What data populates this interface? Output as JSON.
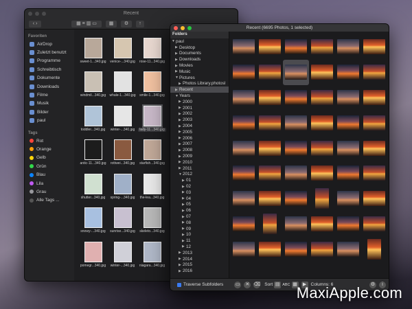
{
  "finder": {
    "title": "Recent",
    "favorites_header": "Favoriten",
    "favorites": [
      "AirDrop",
      "Zuletzt benutzt",
      "Programme",
      "Schreibtisch",
      "Dokumente",
      "Downloads",
      "Filme",
      "Musik",
      "Bilder",
      "paul"
    ],
    "tags_header": "Tags",
    "tags": [
      {
        "label": "Rot",
        "color": "#ff453a"
      },
      {
        "label": "Orange",
        "color": "#ff9f0a"
      },
      {
        "label": "Gelb",
        "color": "#ffd60a"
      },
      {
        "label": "Grün",
        "color": "#32d74b"
      },
      {
        "label": "Blau",
        "color": "#0a84ff"
      },
      {
        "label": "Lila",
        "color": "#bf5af2"
      },
      {
        "label": "Grau",
        "color": "#98989d"
      },
      {
        "label": "Alle Tags ...",
        "color": "#555555"
      }
    ],
    "files": [
      "sweet-1...340.jpg",
      "venice-...340.jpg",
      "rose-11...340.jpg",
      "windmil...340.jpg",
      "whale-1...340.jpg",
      "smile-1...340.jpg",
      "toddler...340.jpg",
      "winter-...340.jpg",
      "lady-11...340.jpg",
      "antic-11...340.jpg",
      "rottwei...340.jpg",
      "starfish...340.jpg",
      "shutter...340.jpg",
      "spring-...340.jpg",
      "the-lea...340.jpg",
      "snowy-...340.jpg",
      "sunrise...340.jpg",
      "skeleto...340.jpg",
      "pomegr...340.jpg",
      "winter-...340.jpg",
      "niagara...340.jpg"
    ],
    "selected_file_index": 8
  },
  "viewer": {
    "title": "Recent (6695 Photos, 1 selected)",
    "folders_header": "Folders",
    "tree": [
      {
        "label": "paul",
        "depth": 0,
        "arrow": "▼"
      },
      {
        "label": "Desktop",
        "depth": 1,
        "arrow": "▶"
      },
      {
        "label": "Documents",
        "depth": 1,
        "arrow": "▶"
      },
      {
        "label": "Downloads",
        "depth": 1,
        "arrow": "▶"
      },
      {
        "label": "Movies",
        "depth": 1,
        "arrow": "▶"
      },
      {
        "label": "Music",
        "depth": 1,
        "arrow": "▶"
      },
      {
        "label": "Pictures",
        "depth": 1,
        "arrow": "▼"
      },
      {
        "label": "Photos Library.photosl",
        "depth": 2,
        "arrow": "▶"
      },
      {
        "label": "Recent",
        "depth": 1,
        "arrow": "▶",
        "selected": true
      },
      {
        "label": "Years",
        "depth": 1,
        "arrow": "▼"
      },
      {
        "label": "2000",
        "depth": 2,
        "arrow": "▶"
      },
      {
        "label": "2001",
        "depth": 2,
        "arrow": "▶"
      },
      {
        "label": "2002",
        "depth": 2,
        "arrow": "▶"
      },
      {
        "label": "2003",
        "depth": 2,
        "arrow": "▶"
      },
      {
        "label": "2004",
        "depth": 2,
        "arrow": "▶"
      },
      {
        "label": "2005",
        "depth": 2,
        "arrow": "▶"
      },
      {
        "label": "2006",
        "depth": 2,
        "arrow": "▶"
      },
      {
        "label": "2007",
        "depth": 2,
        "arrow": "▶"
      },
      {
        "label": "2008",
        "depth": 2,
        "arrow": "▶"
      },
      {
        "label": "2009",
        "depth": 2,
        "arrow": "▶"
      },
      {
        "label": "2010",
        "depth": 2,
        "arrow": "▶"
      },
      {
        "label": "2011",
        "depth": 2,
        "arrow": "▶"
      },
      {
        "label": "2012",
        "depth": 2,
        "arrow": "▼"
      },
      {
        "label": "01",
        "depth": 3,
        "arrow": "▶"
      },
      {
        "label": "02",
        "depth": 3,
        "arrow": "▶"
      },
      {
        "label": "03",
        "depth": 3,
        "arrow": "▶"
      },
      {
        "label": "04",
        "depth": 3,
        "arrow": "▶"
      },
      {
        "label": "05",
        "depth": 3,
        "arrow": "▶"
      },
      {
        "label": "06",
        "depth": 3,
        "arrow": "▶"
      },
      {
        "label": "07",
        "depth": 3,
        "arrow": "▶"
      },
      {
        "label": "08",
        "depth": 3,
        "arrow": "▶"
      },
      {
        "label": "09",
        "depth": 3,
        "arrow": "▶"
      },
      {
        "label": "10",
        "depth": 3,
        "arrow": "▶"
      },
      {
        "label": "11",
        "depth": 3,
        "arrow": "▶"
      },
      {
        "label": "12",
        "depth": 3,
        "arrow": "▶"
      },
      {
        "label": "2013",
        "depth": 2,
        "arrow": "▶"
      },
      {
        "label": "2014",
        "depth": 2,
        "arrow": "▶"
      },
      {
        "label": "2015",
        "depth": 2,
        "arrow": "▶"
      },
      {
        "label": "2016",
        "depth": 2,
        "arrow": "▶"
      }
    ],
    "selected_photo_index": 8,
    "bottom": {
      "traverse_label": "Traverse Subfolders",
      "sort_label": "Sort",
      "abc_label": "ABC",
      "columns_label": "Columns: 6",
      "info_icon": "info-icon"
    }
  },
  "watermark": "MaxiApple.com"
}
